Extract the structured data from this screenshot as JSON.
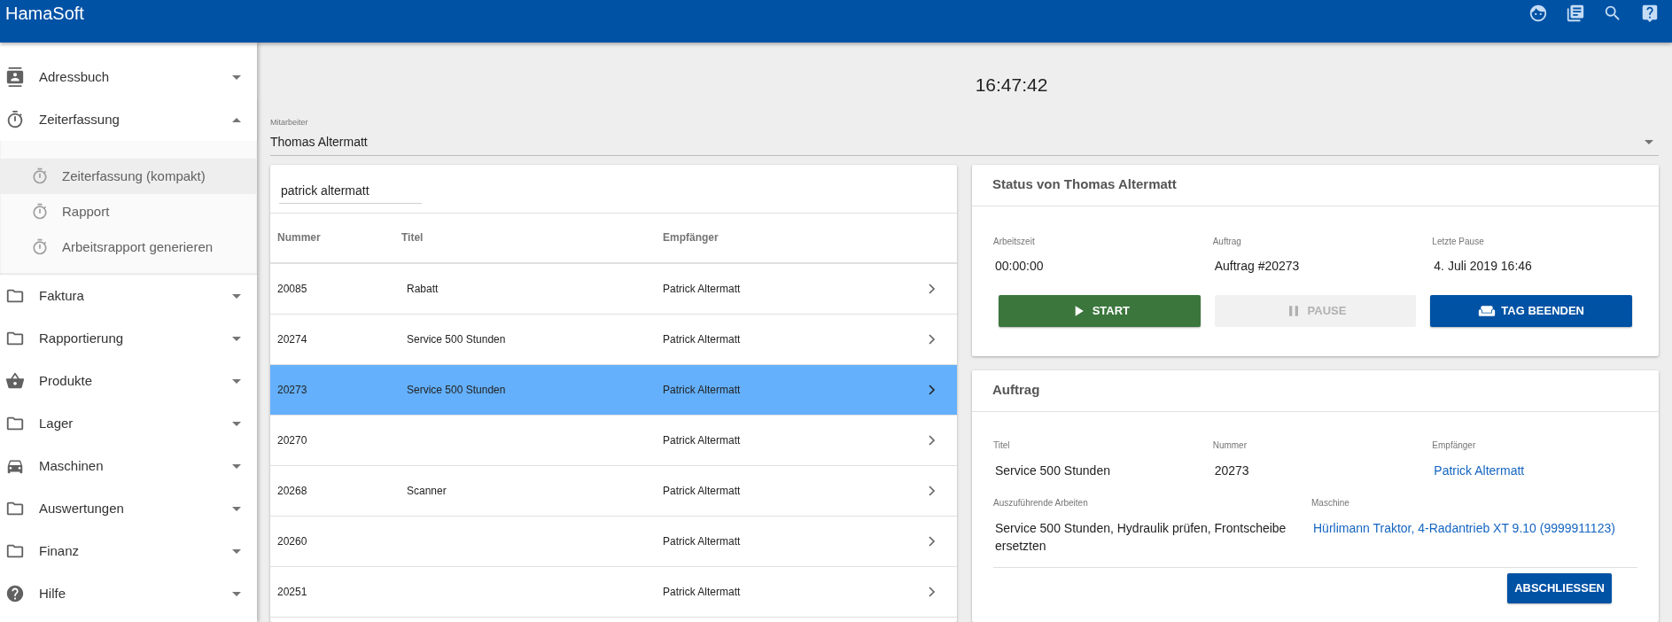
{
  "app": {
    "title": "HamaSoft"
  },
  "sidebar": {
    "items": [
      {
        "label": "Adressbuch",
        "kind": "contacts",
        "expanded": false
      },
      {
        "label": "Zeiterfassung",
        "kind": "timer",
        "expanded": true,
        "children": [
          {
            "label": "Zeiterfassung (kompakt)",
            "selected": true
          },
          {
            "label": "Rapport",
            "selected": false
          },
          {
            "label": "Arbeitsrapport generieren",
            "selected": false
          }
        ]
      },
      {
        "label": "Faktura",
        "kind": "folder",
        "expanded": false
      },
      {
        "label": "Rapportierung",
        "kind": "folder",
        "expanded": false
      },
      {
        "label": "Produkte",
        "kind": "basket",
        "expanded": false
      },
      {
        "label": "Lager",
        "kind": "folder",
        "expanded": false
      },
      {
        "label": "Maschinen",
        "kind": "car",
        "expanded": false
      },
      {
        "label": "Auswertungen",
        "kind": "folder",
        "expanded": false
      },
      {
        "label": "Finanz",
        "kind": "folder",
        "expanded": false
      },
      {
        "label": "Hilfe",
        "kind": "help",
        "expanded": false
      }
    ]
  },
  "clock": "16:47:42",
  "employee_select": {
    "label": "Mitarbeiter",
    "value": "Thomas Altermatt"
  },
  "orders": {
    "search": {
      "value": "patrick altermatt"
    },
    "columns": [
      "Nummer",
      "Titel",
      "Empfänger"
    ],
    "rows": [
      {
        "nummer": "20085",
        "titel": "Rabatt",
        "empfaenger": "Patrick Altermatt",
        "selected": false
      },
      {
        "nummer": "20274",
        "titel": "Service 500 Stunden",
        "empfaenger": "Patrick Altermatt",
        "selected": false
      },
      {
        "nummer": "20273",
        "titel": "Service 500 Stunden",
        "empfaenger": "Patrick Altermatt",
        "selected": true
      },
      {
        "nummer": "20270",
        "empfaenger": "Patrick Altermatt",
        "selected": false
      },
      {
        "nummer": "20268",
        "titel": "Scanner",
        "empfaenger": "Patrick Altermatt",
        "selected": false
      },
      {
        "nummer": "20260",
        "empfaenger": "Patrick Altermatt",
        "selected": false
      },
      {
        "nummer": "20251",
        "empfaenger": "Patrick Altermatt",
        "selected": false
      }
    ]
  },
  "status": {
    "title": "Status von Thomas Altermatt",
    "fields": [
      {
        "label": "Arbeitszeit",
        "value": "00:00:00"
      },
      {
        "label": "Auftrag",
        "value": "Auftrag #20273"
      },
      {
        "label": "Letzte Pause",
        "value": "4. Juli 2019 16:46"
      }
    ],
    "buttons": [
      {
        "label": "START",
        "kind": "start",
        "disabled": false
      },
      {
        "label": "PAUSE",
        "kind": "pause",
        "disabled": true
      },
      {
        "label": "TAG BEENDEN",
        "kind": "end",
        "disabled": false
      }
    ]
  },
  "order": {
    "title": "Auftrag",
    "fields": [
      {
        "label": "Titel",
        "value": "Service 500 Stunden",
        "kind": "text"
      },
      {
        "label": "Nummer",
        "value": "20273",
        "kind": "text"
      },
      {
        "label": "Empfänger",
        "value": "Patrick Altermatt",
        "kind": "link"
      }
    ],
    "fields_2": [
      {
        "label": "Auszuführende Arbeiten",
        "value": "Service 500 Stunden, Hydraulik prüfen, Frontscheibe ersetzten",
        "kind": "text"
      },
      {
        "label": "Maschine",
        "value": "Hürlimann Traktor, 4-Radantrieb XT 9.10 (9999911123)",
        "kind": "link"
      }
    ],
    "button": "ABSCHLIESSEN"
  }
}
